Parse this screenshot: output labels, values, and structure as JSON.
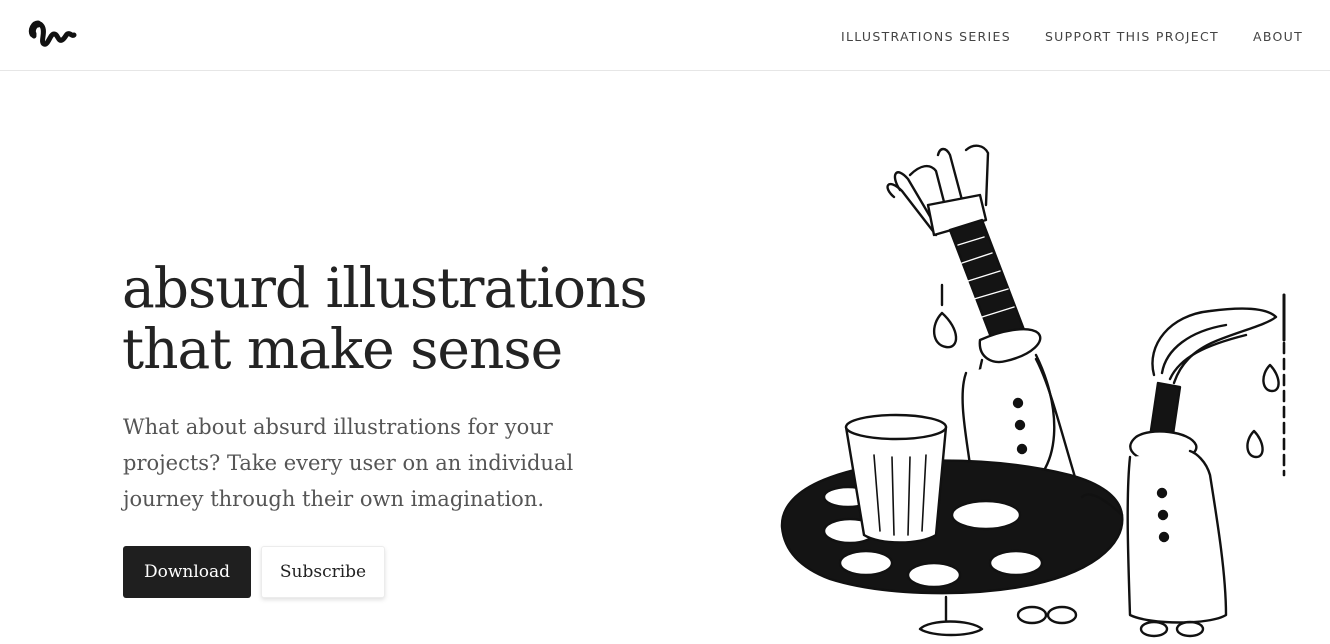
{
  "header": {
    "nav": [
      {
        "label": "ILLUSTRATIONS SERIES"
      },
      {
        "label": "SUPPORT THIS PROJECT"
      },
      {
        "label": "ABOUT"
      }
    ]
  },
  "hero": {
    "title_line1": "absurd illustrations",
    "title_line2": "that make sense",
    "description": "What about absurd illustrations for your projects? Take every user on an individual journey through their own imagination.",
    "download_label": "Download",
    "subscribe_label": "Subscribe"
  },
  "colors": {
    "ink": "#1f1f1f",
    "background": "#ffffff",
    "body_text": "#555555"
  },
  "icons": {
    "logo": "squiggle-logo-icon"
  }
}
